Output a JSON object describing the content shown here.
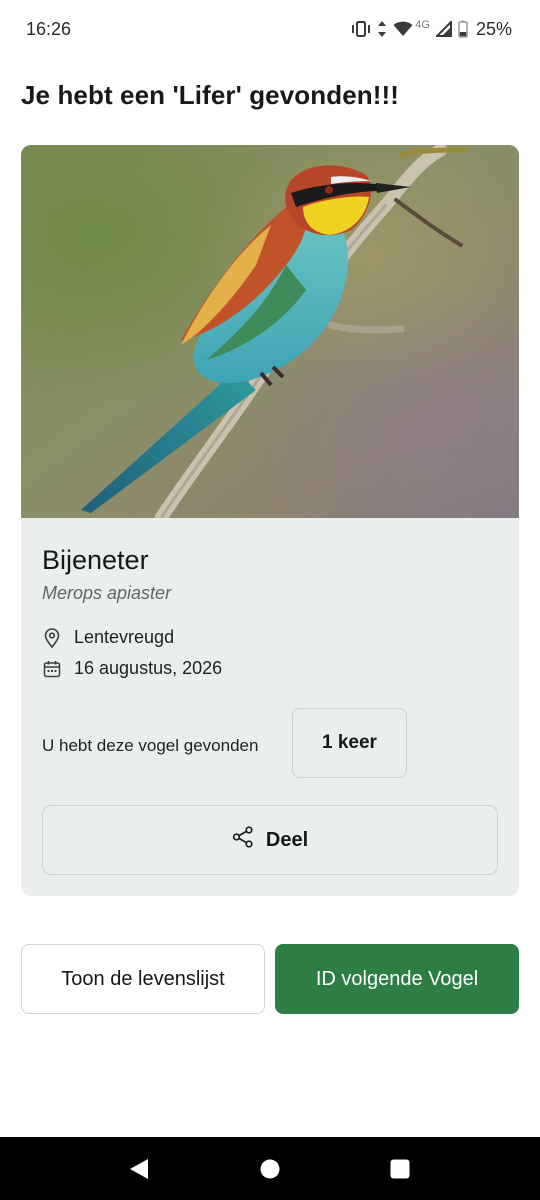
{
  "status_bar": {
    "time": "16:26",
    "network": "4G",
    "battery": "25%"
  },
  "page": {
    "title": "Je hebt een 'Lifer' gevonden!!!"
  },
  "bird": {
    "common_name": "Bijeneter",
    "latin_name": "Merops apiaster",
    "location": "Lentevreugd",
    "date": "16 augustus, 2026",
    "photo_icon": "bee-eater-photo"
  },
  "sightings": {
    "label": "U hebt deze vogel gevonden",
    "count": "1 keer"
  },
  "actions": {
    "share_label": "Deel",
    "lifelist_label": "Toon de levenslijst",
    "next_label": "ID volgende Vogel"
  },
  "colors": {
    "accent": "#2e7d45",
    "card_bg": "#eaeeec",
    "nav_bg": "#000000"
  },
  "icons": {
    "location": "location-pin-icon",
    "date": "calendar-icon",
    "share": "share-icon"
  }
}
